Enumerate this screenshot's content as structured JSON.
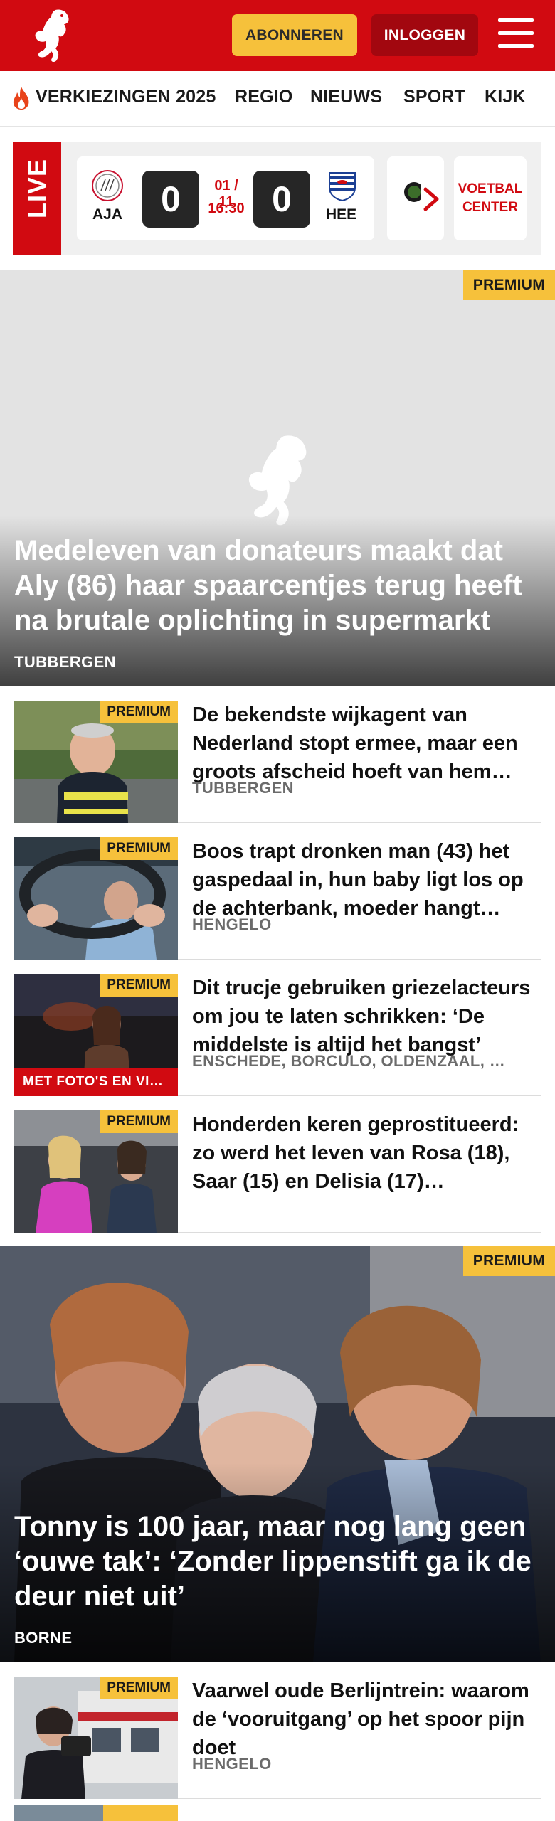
{
  "header": {
    "subscribe_label": "ABONNEREN",
    "login_label": "INLOGGEN",
    "brand_color": "#d10a11",
    "accent_color": "#f6c13b"
  },
  "nav": {
    "items": [
      {
        "label": "VERKIEZINGEN 2025",
        "icon": "flame-icon"
      },
      {
        "label": "REGIO"
      },
      {
        "label": "NIEUWS"
      },
      {
        "label": "SPORT"
      },
      {
        "label": "KIJK"
      }
    ]
  },
  "live": {
    "label": "LIVE",
    "match": {
      "home_abbr": "AJA",
      "away_abbr": "HEE",
      "home_score": "0",
      "away_score": "0",
      "date": "01 / 11",
      "time": "16:30"
    },
    "voetbal_center_label": "VOETBAL CENTER"
  },
  "premium_label": "PREMIUM",
  "hero_1": {
    "title": "Medeleven van donateurs maakt dat Aly (86) haar spaarcentjes terug heeft na brutale oplichting in supermarkt",
    "location": "TUBBERGEN"
  },
  "articles": [
    {
      "title": "De bekendste wijkagent van Nederland stopt ermee, maar een groots afscheid hoeft van hem…",
      "location": "TUBBERGEN",
      "premium": true,
      "caption": ""
    },
    {
      "title": "Boos trapt dronken man (43) het gaspedaal in, hun baby ligt los op de achterbank, moeder hangt…",
      "location": "HENGELO",
      "premium": true,
      "caption": ""
    },
    {
      "title": "Dit trucje gebruiken griezelac­teurs om jou te laten schrikken: ‘De middelste is altijd het bangst’",
      "location": "ENSCHEDE, BORCULO, OLDENZAAL, …",
      "premium": true,
      "caption": "MET FOTO'S EN VI…"
    },
    {
      "title": "Honderden keren geprostitueerd: zo werd het leven van Rosa (18), Saar (15) en Delisia (17)…",
      "location": "",
      "premium": true,
      "caption": ""
    }
  ],
  "hero_2": {
    "title": "Tonny is 100 jaar, maar nog lang geen ‘ouwe tak’: ‘Zonder lippenstift ga ik de deur niet uit’",
    "location": "BORNE"
  },
  "articles_2": [
    {
      "title": "Vaarwel oude Berlijntrein: waarom de ‘vooruitgang’ op het spoor pijn doet",
      "location": "HENGELO",
      "premium": true
    }
  ]
}
